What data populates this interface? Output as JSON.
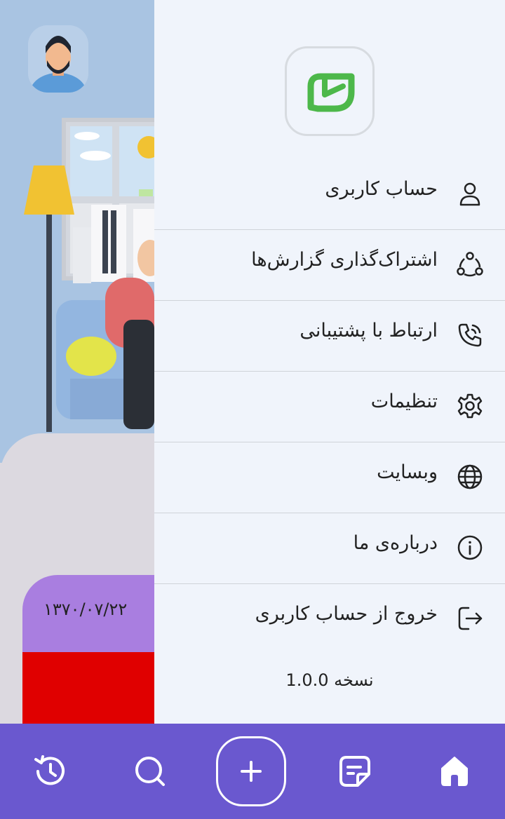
{
  "background": {
    "card_date": "۱۳۷۰/۰۷/۲۲",
    "colors": {
      "room": "#a9c4e2",
      "card_purple": "#a97ee0",
      "card_red": "#e00000"
    }
  },
  "drawer": {
    "logo": "leaf-logo",
    "items": [
      {
        "label": "حساب کاربری",
        "icon": "user-icon"
      },
      {
        "label": "اشتراک‌گذاری گزارش‌ها",
        "icon": "share-icon"
      },
      {
        "label": "ارتباط با پشتیبانی",
        "icon": "phone-call-icon"
      },
      {
        "label": "تنظیمات",
        "icon": "gear-icon"
      },
      {
        "label": "وبسایت",
        "icon": "globe-icon"
      },
      {
        "label": "درباره‌ی ما",
        "icon": "info-icon"
      },
      {
        "label": "خروج از حساب کاربری",
        "icon": "logout-icon"
      }
    ],
    "version": "نسخه 1.0.0"
  },
  "bottom_nav": {
    "items": [
      "history-icon",
      "search-icon",
      "add-icon",
      "document-icon",
      "home-icon"
    ],
    "colors": {
      "bar": "#6a58cf",
      "icon": "#ffffff"
    }
  }
}
